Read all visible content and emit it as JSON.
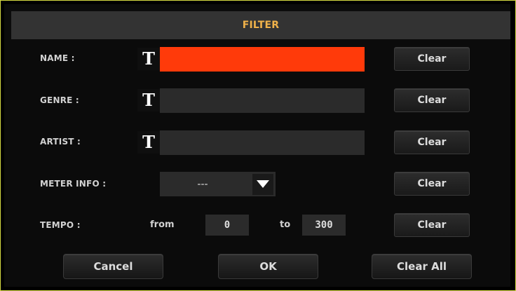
{
  "dialog": {
    "title": "FILTER"
  },
  "rows": {
    "name": {
      "label": "NAME :",
      "value": "",
      "text_icon": "T"
    },
    "genre": {
      "label": "GENRE :",
      "value": "",
      "text_icon": "T"
    },
    "artist": {
      "label": "ARTIST :",
      "value": "",
      "text_icon": "T"
    },
    "meter": {
      "label": "METER INFO :",
      "selected": "---"
    },
    "tempo": {
      "label": "TEMPO :",
      "from_label": "from",
      "from_value": "0",
      "to_label": "to",
      "to_value": "300"
    }
  },
  "clear_label": "Clear",
  "buttons": {
    "cancel": "Cancel",
    "ok": "OK",
    "clear_all": "Clear All"
  },
  "colors": {
    "title_text": "#f0b24a",
    "active_field": "#ff3a0a",
    "frame_border": "#d7db43"
  },
  "icons": {
    "text_edit": "text-edit-icon",
    "dropdown": "dropdown-arrow-icon"
  }
}
